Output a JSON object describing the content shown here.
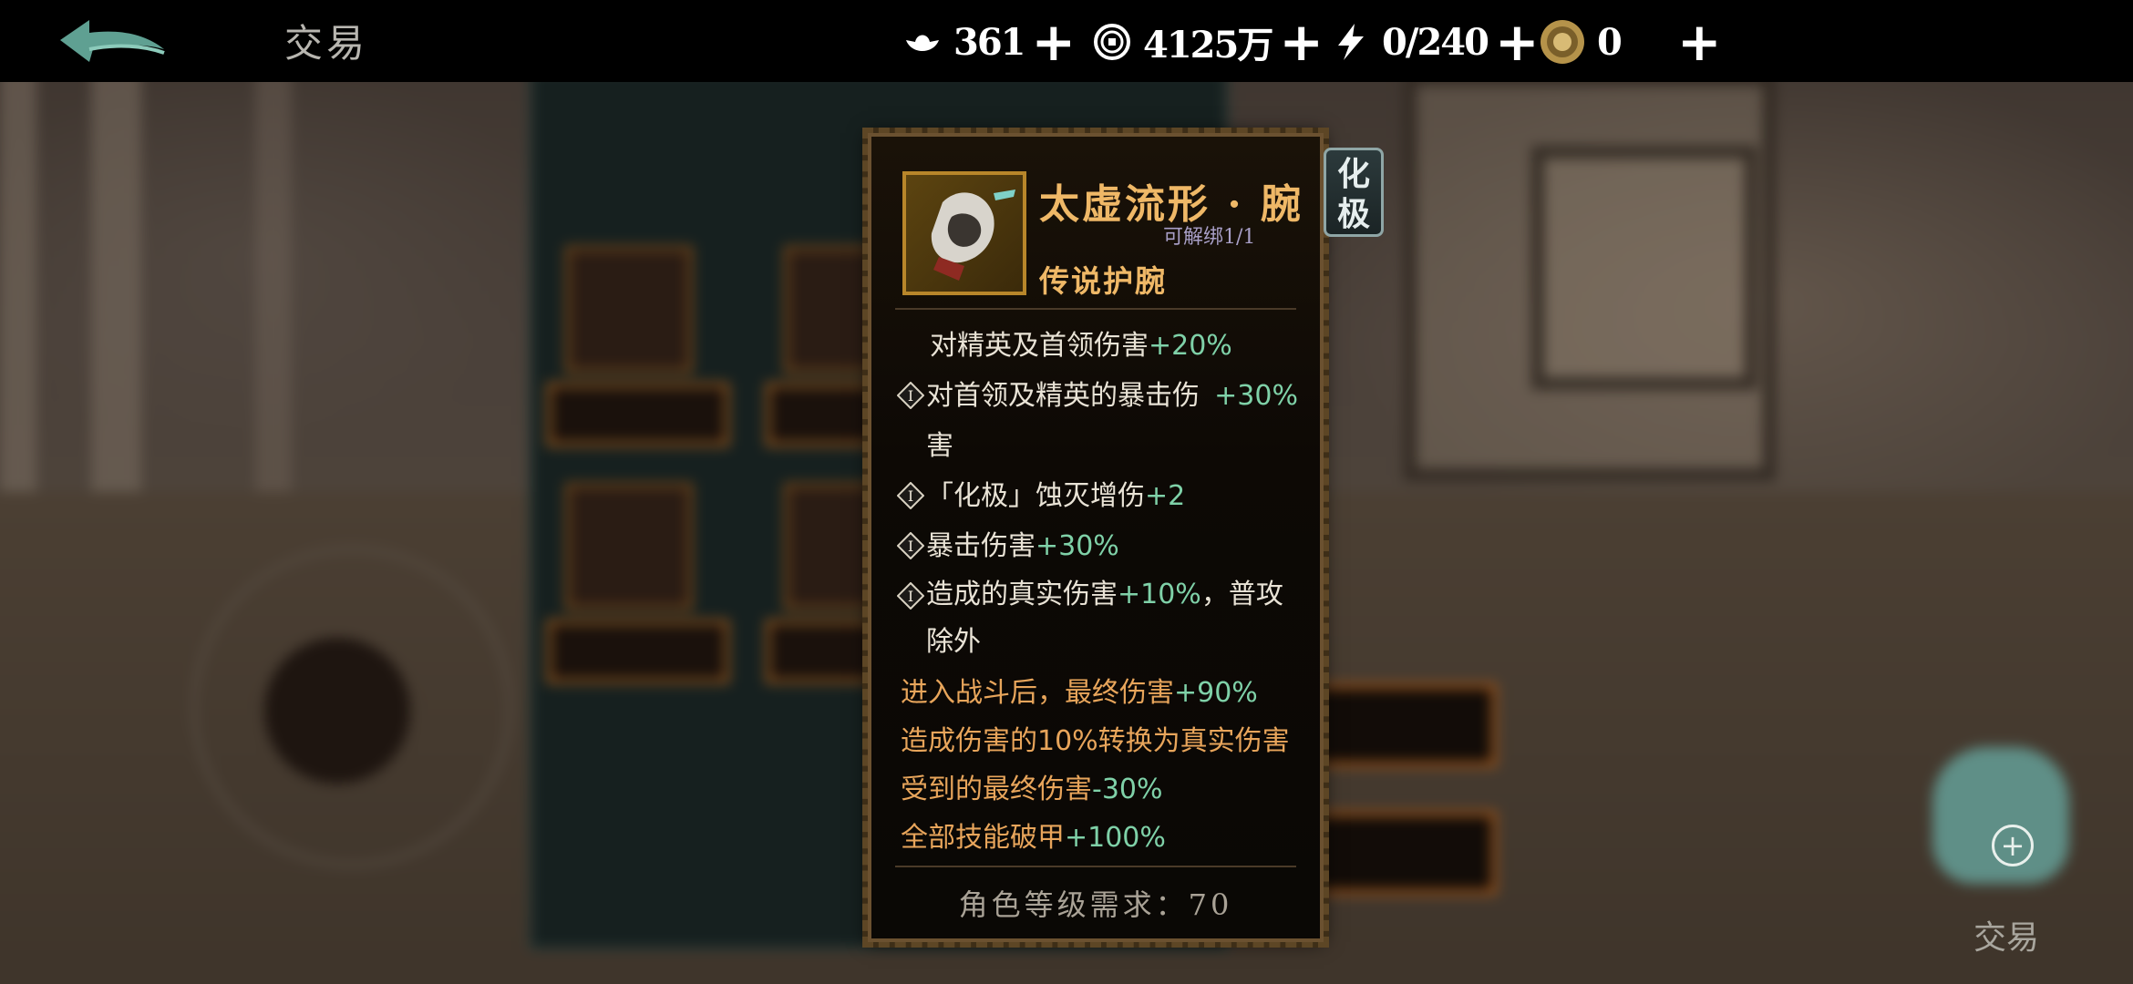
{
  "header": {
    "title": "交易"
  },
  "resources": [
    {
      "icon": "ingot-icon",
      "value": "361"
    },
    {
      "icon": "coin-icon",
      "value": "4125万"
    },
    {
      "icon": "stamina-icon",
      "value": "0/240"
    },
    {
      "icon": "medal-coin-icon",
      "value": "0"
    }
  ],
  "tooltip": {
    "item_name": "太虚流形 · 腕",
    "bind_status": "可解绑1/1",
    "item_type": "传说护腕",
    "badge": "化极",
    "stats": [
      {
        "text": "对精英及首领伤害",
        "bonus": "+20%",
        "mark": false
      },
      {
        "text": "对首领及精英的暴击伤害",
        "bonus": "+30%",
        "mark": true
      },
      {
        "text": "「化极」蚀灭增伤",
        "bonus": "+2",
        "mark": true
      },
      {
        "text": "暴击伤害",
        "bonus": "+30%",
        "mark": true
      },
      {
        "text": "造成的真实伤害",
        "bonus": "+10%",
        "suffix": "，普攻除外",
        "mark": true
      }
    ],
    "effects": [
      {
        "text": "进入战斗后，最终伤害",
        "bonus": "+90%"
      },
      {
        "text": "造成伤害的10%转换为真实伤害",
        "bonus": ""
      },
      {
        "text": "受到的最终伤害",
        "bonus": "-30%"
      },
      {
        "text": "全部技能破甲",
        "bonus": "+100%"
      }
    ],
    "requirement": "角色等级需求：70"
  },
  "background": {
    "bag_label": "交易"
  },
  "colors": {
    "gold_title": "#efb867",
    "stat_green": "#7fd1a8",
    "effect_orange": "#e8a55b",
    "bind_purple": "#a89fc7"
  }
}
